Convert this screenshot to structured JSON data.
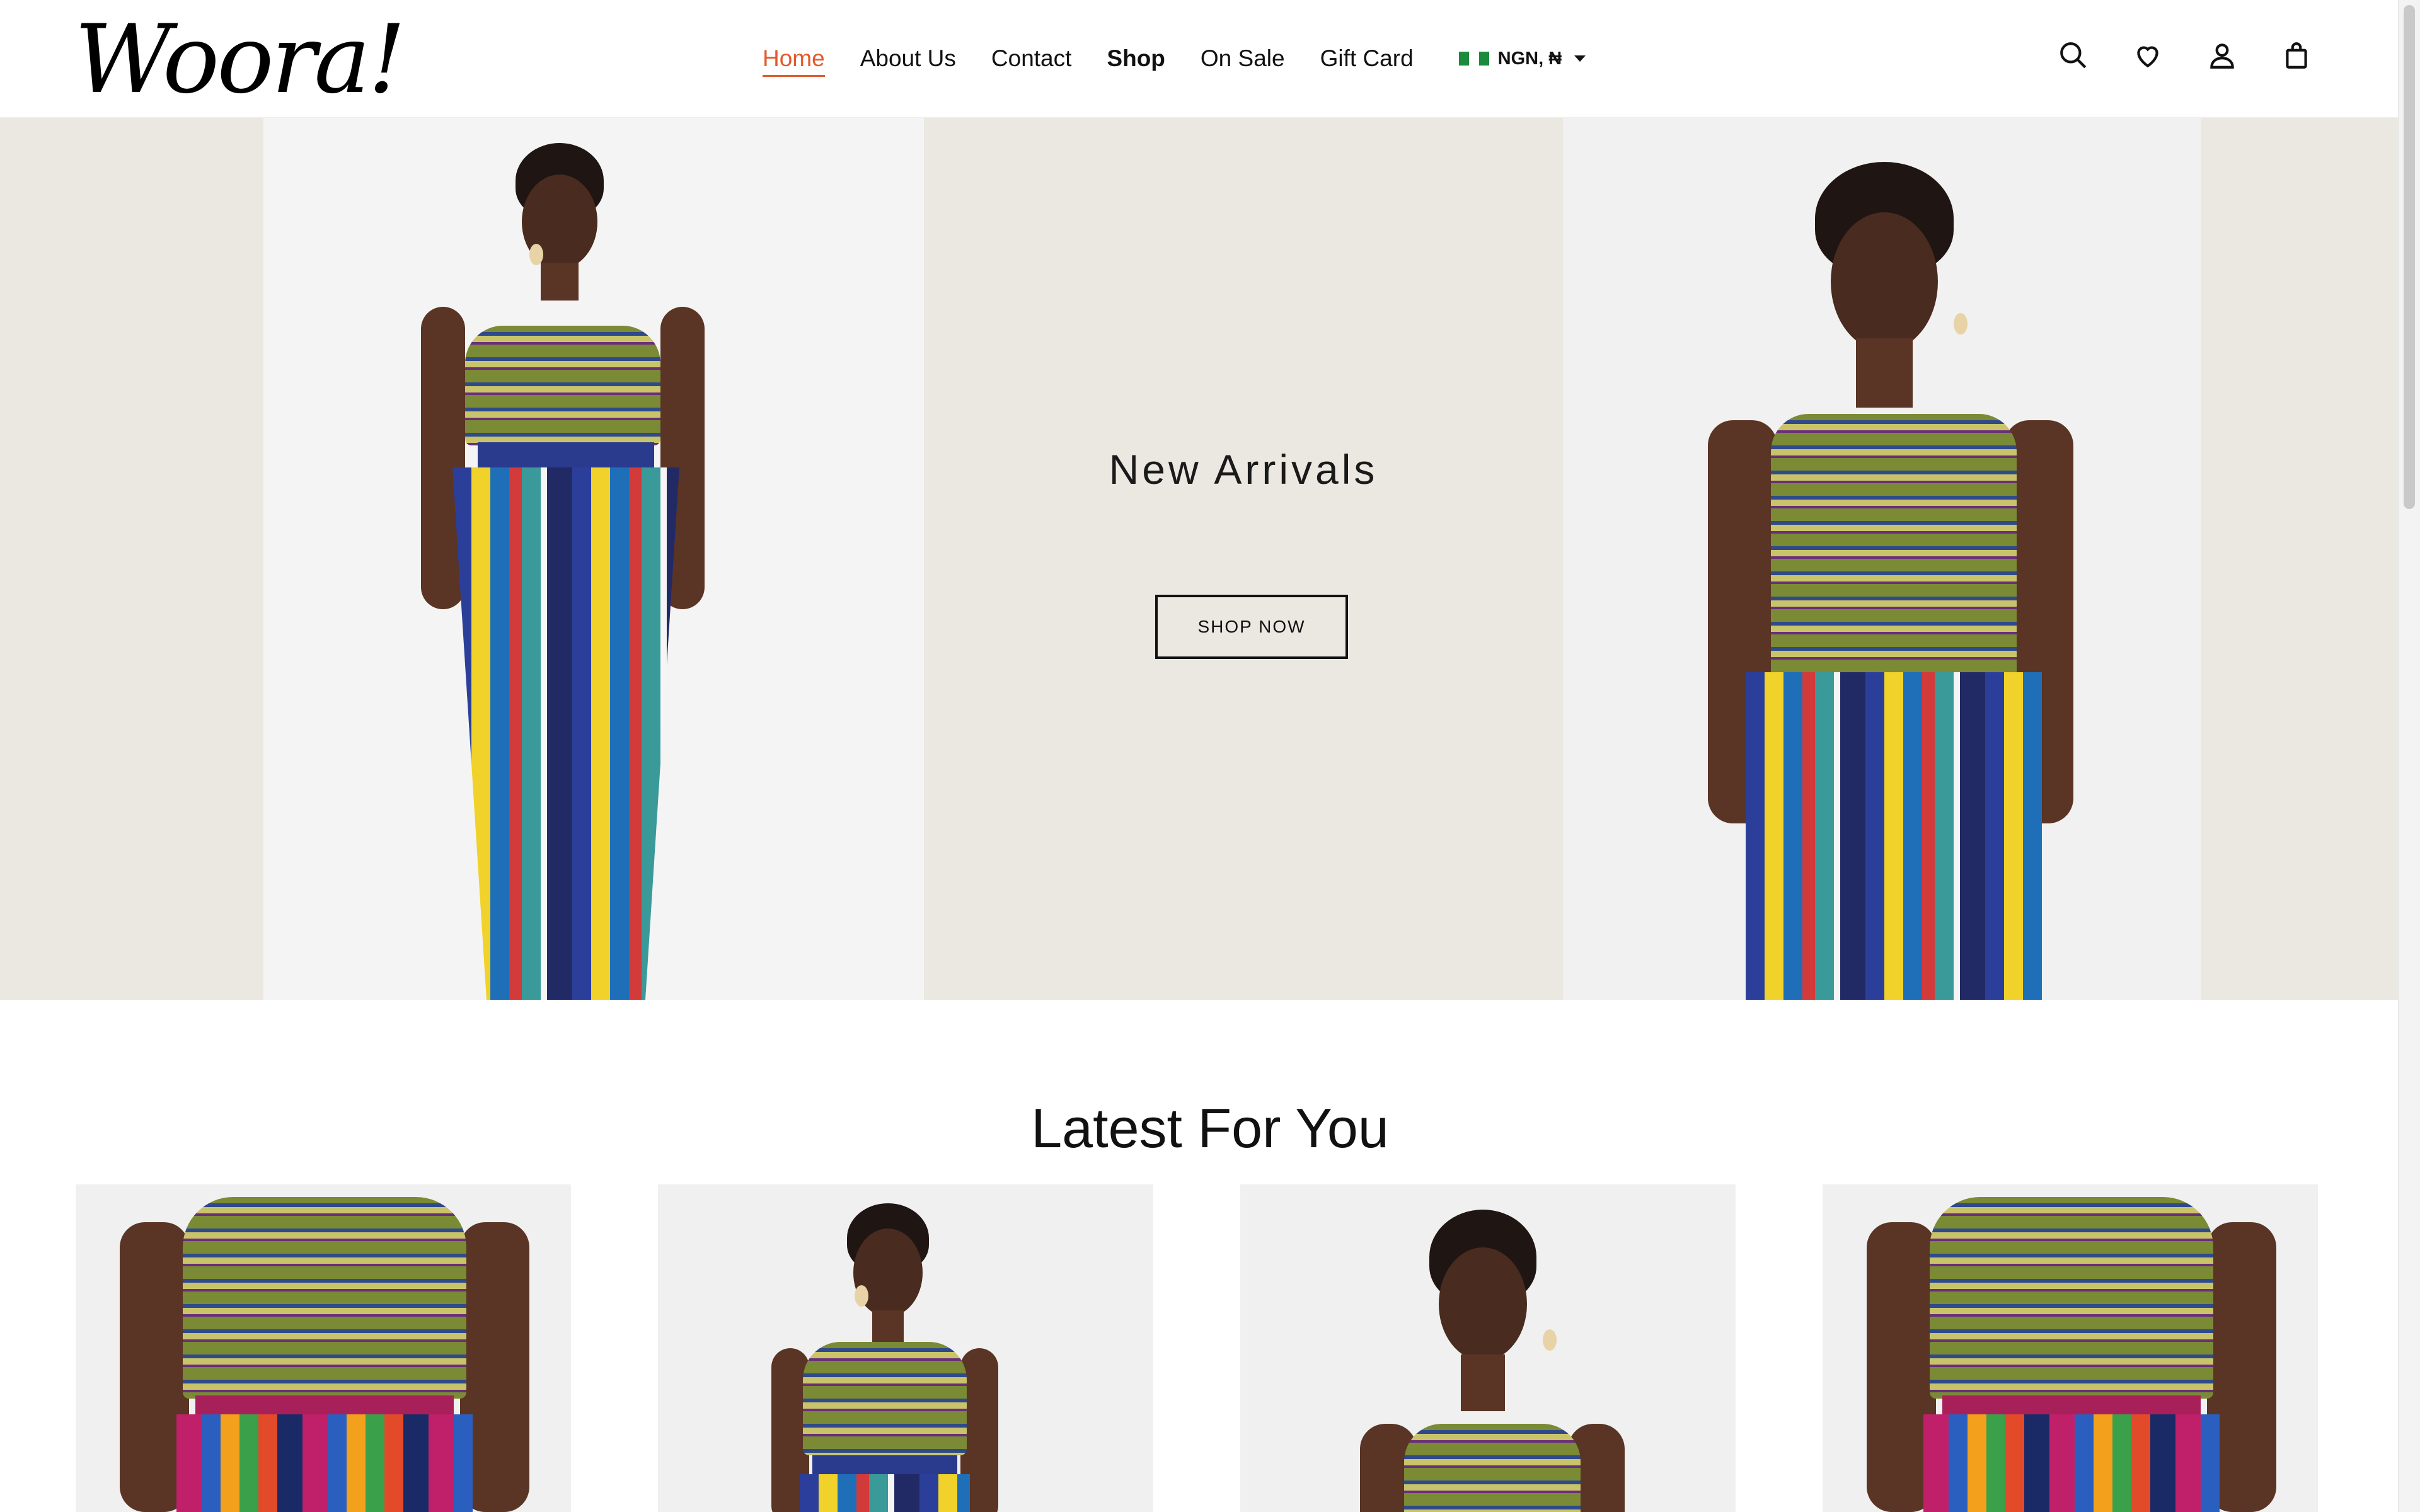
{
  "brand": {
    "logo_text": "Woora!"
  },
  "nav": {
    "items": [
      {
        "label": "Home",
        "active": true,
        "bold": false
      },
      {
        "label": "About Us",
        "active": false,
        "bold": false
      },
      {
        "label": "Contact",
        "active": false,
        "bold": false
      },
      {
        "label": "Shop",
        "active": false,
        "bold": true
      },
      {
        "label": "On Sale",
        "active": false,
        "bold": false
      },
      {
        "label": "Gift Card",
        "active": false,
        "bold": false
      }
    ],
    "currency_label": "NGN, ₦"
  },
  "header_icons": [
    "search-icon",
    "heart-icon",
    "account-icon",
    "bag-icon"
  ],
  "hero": {
    "title": "New Arrivals",
    "cta_label": "SHOP NOW",
    "background_color": "#ebe8e2"
  },
  "latest": {
    "title": "Latest For You",
    "products": [
      {
        "name": "product-1"
      },
      {
        "name": "product-2"
      },
      {
        "name": "product-3"
      },
      {
        "name": "product-4"
      }
    ]
  },
  "colors": {
    "accent": "#e25a2b",
    "text": "#111111"
  }
}
